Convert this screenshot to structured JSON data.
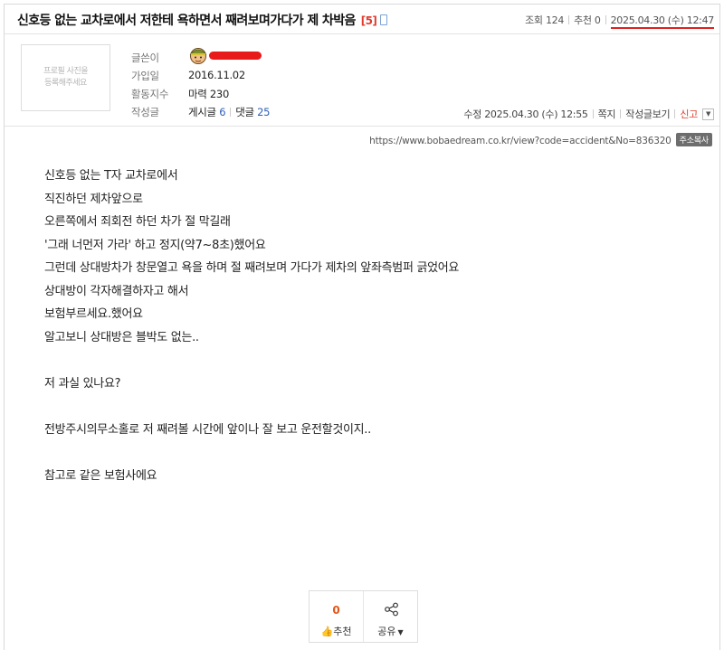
{
  "post": {
    "title": "신호등 없는 교차로에서 저한테 욕하면서 째려보며가다가 제 차박음",
    "comment_count": "[5]",
    "views_label": "조회",
    "views": "124",
    "recommend_label": "추천",
    "recommend": "0",
    "date": "2025.04.30 (수) 12:47"
  },
  "author": {
    "photo_placeholder_1": "프로필 사진을",
    "photo_placeholder_2": "등록해주세요",
    "writer_label": "글쓴이",
    "joined_label": "가입일",
    "joined": "2016.11.02",
    "activity_label": "활동지수",
    "activity": "마력 230",
    "posts_label": "작성글",
    "posts_text": "게시글",
    "posts_count": "6",
    "comments_text": "댓글",
    "comments_count": "25"
  },
  "meta": {
    "modified": "수정 2025.04.30 (수) 12:55",
    "message": "쪽지",
    "view_posts": "작성글보기",
    "report": "신고"
  },
  "url": {
    "text": "https://www.bobaedream.co.kr/view?code=accident&No=836320",
    "copy_label": "주소복사"
  },
  "body": {
    "lines": [
      "신호등 없는 T자 교차로에서",
      "직진하던 제차앞으로",
      "오른쪽에서 죄회전 하던 차가 절 막길래",
      "'그래 너먼저 가라' 하고 정지(약7~8초)했어요",
      "그런데 상대방차가 창문열고 욕을 하며 절 째려보며 가다가 제차의 앞좌측범퍼 긁었어요",
      "상대방이 각자해결하자고 해서",
      "보험부르세요.했어요",
      "알고보니 상대방은 블박도 없는..",
      "",
      "저 과실 있나요?",
      "",
      "전방주시의무소홀로 저 째려볼 시간에 앞이나 잘 보고 운전할것이지..",
      "",
      "참고로 같은 보험사에요"
    ]
  },
  "actions": {
    "recommend_count": "0",
    "recommend_label": "추천",
    "share_label": "공유"
  },
  "colors": {
    "accent_red": "#e03c2f",
    "link_blue": "#2f5fb7",
    "recommend_orange": "#e2561a"
  }
}
